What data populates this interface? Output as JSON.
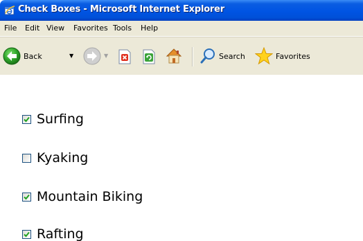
{
  "window": {
    "title": "Check Boxes - Microsoft Internet Explorer"
  },
  "menu": {
    "items": [
      "File",
      "Edit",
      "View",
      "Favorites",
      "Tools",
      "Help"
    ]
  },
  "toolbar": {
    "back_label": "Back",
    "search_label": "Search",
    "favorites_label": "Favorites"
  },
  "checkboxes": [
    {
      "label": "Surfing",
      "checked": true
    },
    {
      "label": "Kyaking",
      "checked": false
    },
    {
      "label": "Mountain Biking",
      "checked": true
    },
    {
      "label": "Rafting",
      "checked": true
    }
  ],
  "colors": {
    "titlebar": "#0054e3",
    "chrome": "#ece9d8",
    "checkbox_border": "#1c5180",
    "checkmark": "#21a121"
  }
}
